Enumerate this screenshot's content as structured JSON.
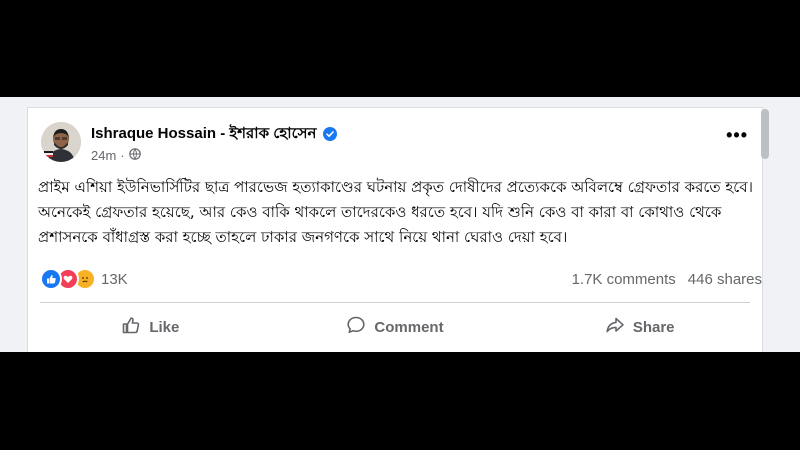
{
  "post": {
    "author": "Ishraque Hossain - ইশরাক হোসেন",
    "time": "24m",
    "visibility_icon": "globe-icon",
    "verified_icon": "verified-badge-icon",
    "text": "প্রাইম এশিয়া ইউনিভার্সিটির ছাত্র পারভেজ হত্যাকাণ্ডের ঘটনায় প্রকৃত দোষীদের প্রত্যেককে অবিলম্বে গ্রেফতার করতে হবে। অনেকেই গ্রেফতার হয়েছে, আর কেও বাকি থাকলে তাদেরকেও ধরতে হবে। যদি শুনি কেও বা কারা বা কোথাও থেকে প্রশাসনকে বাঁধাগ্রস্ত করা হচ্ছে তাহলে ঢাকার জনগণকে সাথে নিয়ে থানা ঘেরাও দেয়া হবে।",
    "reaction_count": "13K",
    "comments": "1.7K comments",
    "shares": "446 shares"
  },
  "actions": {
    "like": "Like",
    "comment": "Comment",
    "share": "Share"
  },
  "colors": {
    "accent": "#1877f2",
    "love": "#f33e58",
    "sad": "#f7b125",
    "secondary_text": "#65676b"
  }
}
